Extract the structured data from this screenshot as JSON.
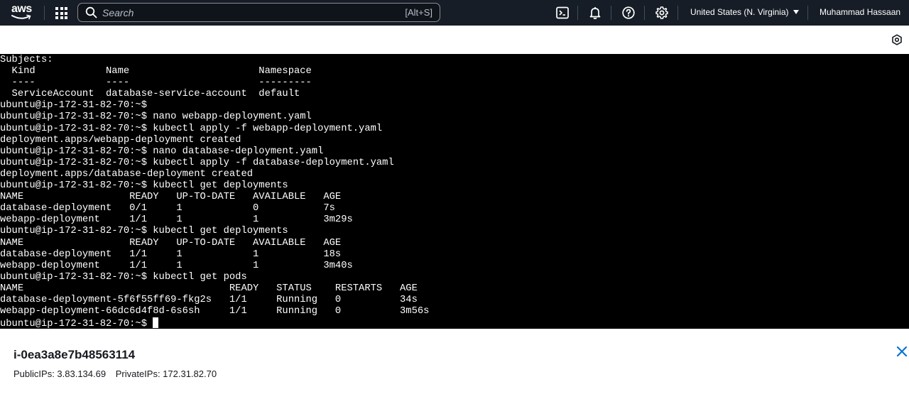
{
  "nav": {
    "logo_text": "aws",
    "search_placeholder": "Search",
    "search_shortcut": "[Alt+S]",
    "region": "United States (N. Virginia)",
    "user": "Muhammad Hassaan",
    "icons": [
      "cloudshell-icon",
      "bell-icon",
      "help-icon",
      "gear-icon"
    ]
  },
  "terminal": {
    "lines": [
      "Subjects:",
      "  Kind            Name                      Namespace",
      "  ----            ----                      ---------",
      "  ServiceAccount  database-service-account  default",
      "ubuntu@ip-172-31-82-70:~$",
      "ubuntu@ip-172-31-82-70:~$ nano webapp-deployment.yaml",
      "ubuntu@ip-172-31-82-70:~$ kubectl apply -f webapp-deployment.yaml",
      "deployment.apps/webapp-deployment created",
      "ubuntu@ip-172-31-82-70:~$ nano database-deployment.yaml",
      "ubuntu@ip-172-31-82-70:~$ kubectl apply -f database-deployment.yaml",
      "deployment.apps/database-deployment created",
      "ubuntu@ip-172-31-82-70:~$ kubectl get deployments",
      "NAME                  READY   UP-TO-DATE   AVAILABLE   AGE",
      "database-deployment   0/1     1            0           7s",
      "webapp-deployment     1/1     1            1           3m29s",
      "ubuntu@ip-172-31-82-70:~$ kubectl get deployments",
      "NAME                  READY   UP-TO-DATE   AVAILABLE   AGE",
      "database-deployment   1/1     1            1           18s",
      "webapp-deployment     1/1     1            1           3m40s",
      "ubuntu@ip-172-31-82-70:~$ kubectl get pods",
      "NAME                                   READY   STATUS    RESTARTS   AGE",
      "database-deployment-5f6f55ff69-fkg2s   1/1     Running   0          34s",
      "webapp-deployment-66dc6d4f8d-6s6sh     1/1     Running   0          3m56s",
      "ubuntu@ip-172-31-82-70:~$ "
    ]
  },
  "instance": {
    "id": "i-0ea3a8e7b48563114",
    "public_ips_label": "PublicIPs: 3.83.134.69",
    "private_ips_label": "PrivateIPs: 172.31.82.70"
  },
  "colors": {
    "nav_bg": "#161d26",
    "terminal_bg": "#000000",
    "accent_blue": "#0972d3"
  }
}
